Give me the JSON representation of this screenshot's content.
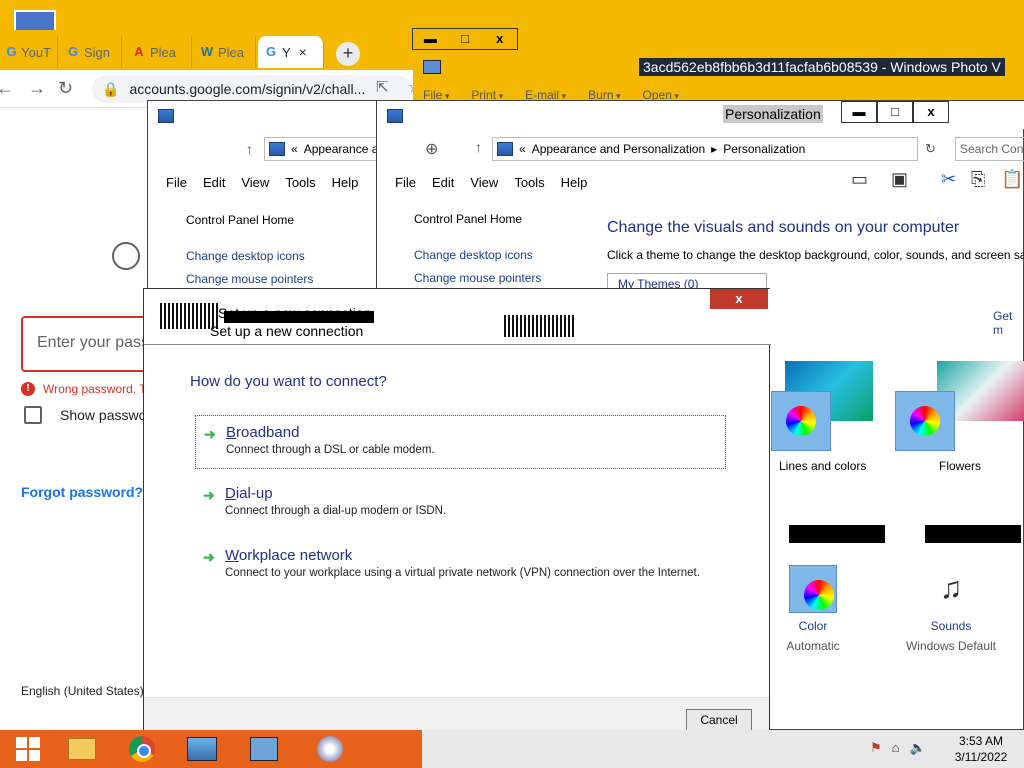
{
  "chrome": {
    "tabs": [
      {
        "favicon": "G",
        "label": "YouT"
      },
      {
        "favicon": "G",
        "label": "Sign"
      },
      {
        "favicon": "A",
        "label": "Plea"
      },
      {
        "favicon": "W",
        "label": "Plea"
      },
      {
        "favicon": "G",
        "label": "Y"
      }
    ],
    "url": "accounts.google.com/signin/v2/chall...",
    "password_placeholder": "Enter your pass",
    "wrong_password": "Wrong password. T",
    "show_password": "Show passwo",
    "forgot_password": "Forgot password?",
    "language": "English (United States)"
  },
  "photo_viewer": {
    "title": "3acd562eb8fbb6b3d11facfab6b08539 - Windows Photo V",
    "menu": [
      "File",
      "Print",
      "E-mail",
      "Burn",
      "Open"
    ]
  },
  "explorer_back": {
    "breadcrumb": "Appearance an",
    "menu": [
      "File",
      "Edit",
      "View",
      "Tools",
      "Help"
    ],
    "links": [
      "Control Panel Home",
      "Change desktop icons",
      "Change mouse pointers"
    ]
  },
  "explorer": {
    "title": "Personalization",
    "breadcrumb_parent": "Appearance and Personalization",
    "breadcrumb_current": "Personalization",
    "search_placeholder": "Search Con",
    "menu": [
      "File",
      "Edit",
      "View",
      "Tools",
      "Help"
    ],
    "links": [
      "Control Panel Home",
      "Change desktop icons",
      "Change mouse pointers"
    ],
    "heading": "Change the visuals and sounds on your computer",
    "subheading": "Click a theme to change the desktop background, color, sounds, and screen sav",
    "my_themes": "My Themes (0)",
    "get_more": "Get m",
    "themes": [
      "Lines and colors",
      "Flowers"
    ],
    "bottom_items": [
      {
        "title": "Color",
        "value": "Automatic"
      },
      {
        "title": "Sounds",
        "value": "Windows Default"
      }
    ]
  },
  "dialog": {
    "title": "Set up a new connection",
    "question": "How do you want to connect?",
    "options": [
      {
        "accel": "B",
        "rest": "roadband",
        "desc": "Connect through a DSL or cable modem."
      },
      {
        "accel": "D",
        "rest": "ial-up",
        "desc": "Connect through a dial-up modem or ISDN."
      },
      {
        "accel": "W",
        "rest": "orkplace network",
        "desc": "Connect to your workplace using a virtual private network (VPN) connection over the Internet."
      }
    ],
    "cancel": "Cancel",
    "close_glyph": "x"
  },
  "taskbar": {
    "time": "3:53 AM",
    "date": "3/11/2022"
  },
  "caption_glyphs": {
    "minimize": "▬",
    "maximize": "□",
    "close": "x"
  }
}
